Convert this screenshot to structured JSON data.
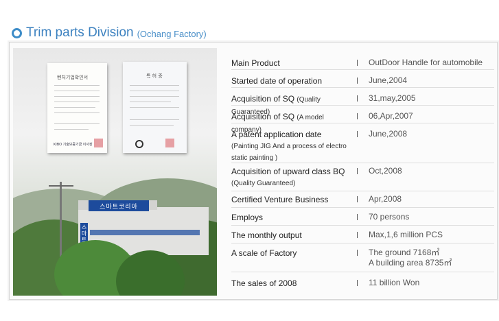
{
  "title": {
    "main": "Trim parts Division",
    "sub": "(Ochang Factory)"
  },
  "colors": {
    "accent": "#3d82c0",
    "sign": "#1d4b9c"
  },
  "rows": [
    {
      "label": "Main Product",
      "note": "",
      "value": "OutDoor Handle for automobile",
      "value2": ""
    },
    {
      "label": "Started date of operation",
      "note": "",
      "value": "June,2004",
      "value2": ""
    },
    {
      "label": "Acquisition of SQ",
      "note": "(Quality Guaranteed)",
      "value": "31,may,2005",
      "value2": ""
    },
    {
      "label": "Acquisition of SQ",
      "note": "(A model company)",
      "value": "06,Apr,2007",
      "value2": ""
    },
    {
      "label": "A patent application date",
      "note": "(Painting JIG And a process of electro static painting )",
      "value": "June,2008",
      "value2": ""
    },
    {
      "label": "Acquisition of upward class BQ",
      "note": "(Quality Guaranteed)",
      "value": "Oct,2008",
      "value2": ""
    },
    {
      "label": "Certified Venture Business",
      "note": "",
      "value": "Apr,2008",
      "value2": ""
    },
    {
      "label": "Employs",
      "note": "",
      "value": "70 persons",
      "value2": ""
    },
    {
      "label": "The monthly output",
      "note": "",
      "value": "Max,1,6 million PCS",
      "value2": ""
    },
    {
      "label": "A scale of Factory",
      "note": "",
      "value": "The ground 7168㎡",
      "value2": "A building area 8735㎡"
    },
    {
      "label": "The sales of 2008",
      "note": "",
      "value": "11 billion Won",
      "value2": ""
    }
  ],
  "photo": {
    "cert1_heading": "벤처기업확인서",
    "cert1_footer": "KIBO 기술보증기금 이사장",
    "cert2_heading": "특 허 증",
    "sign_text": "스마트코리아",
    "sign_vertical": "스마트코리아"
  }
}
